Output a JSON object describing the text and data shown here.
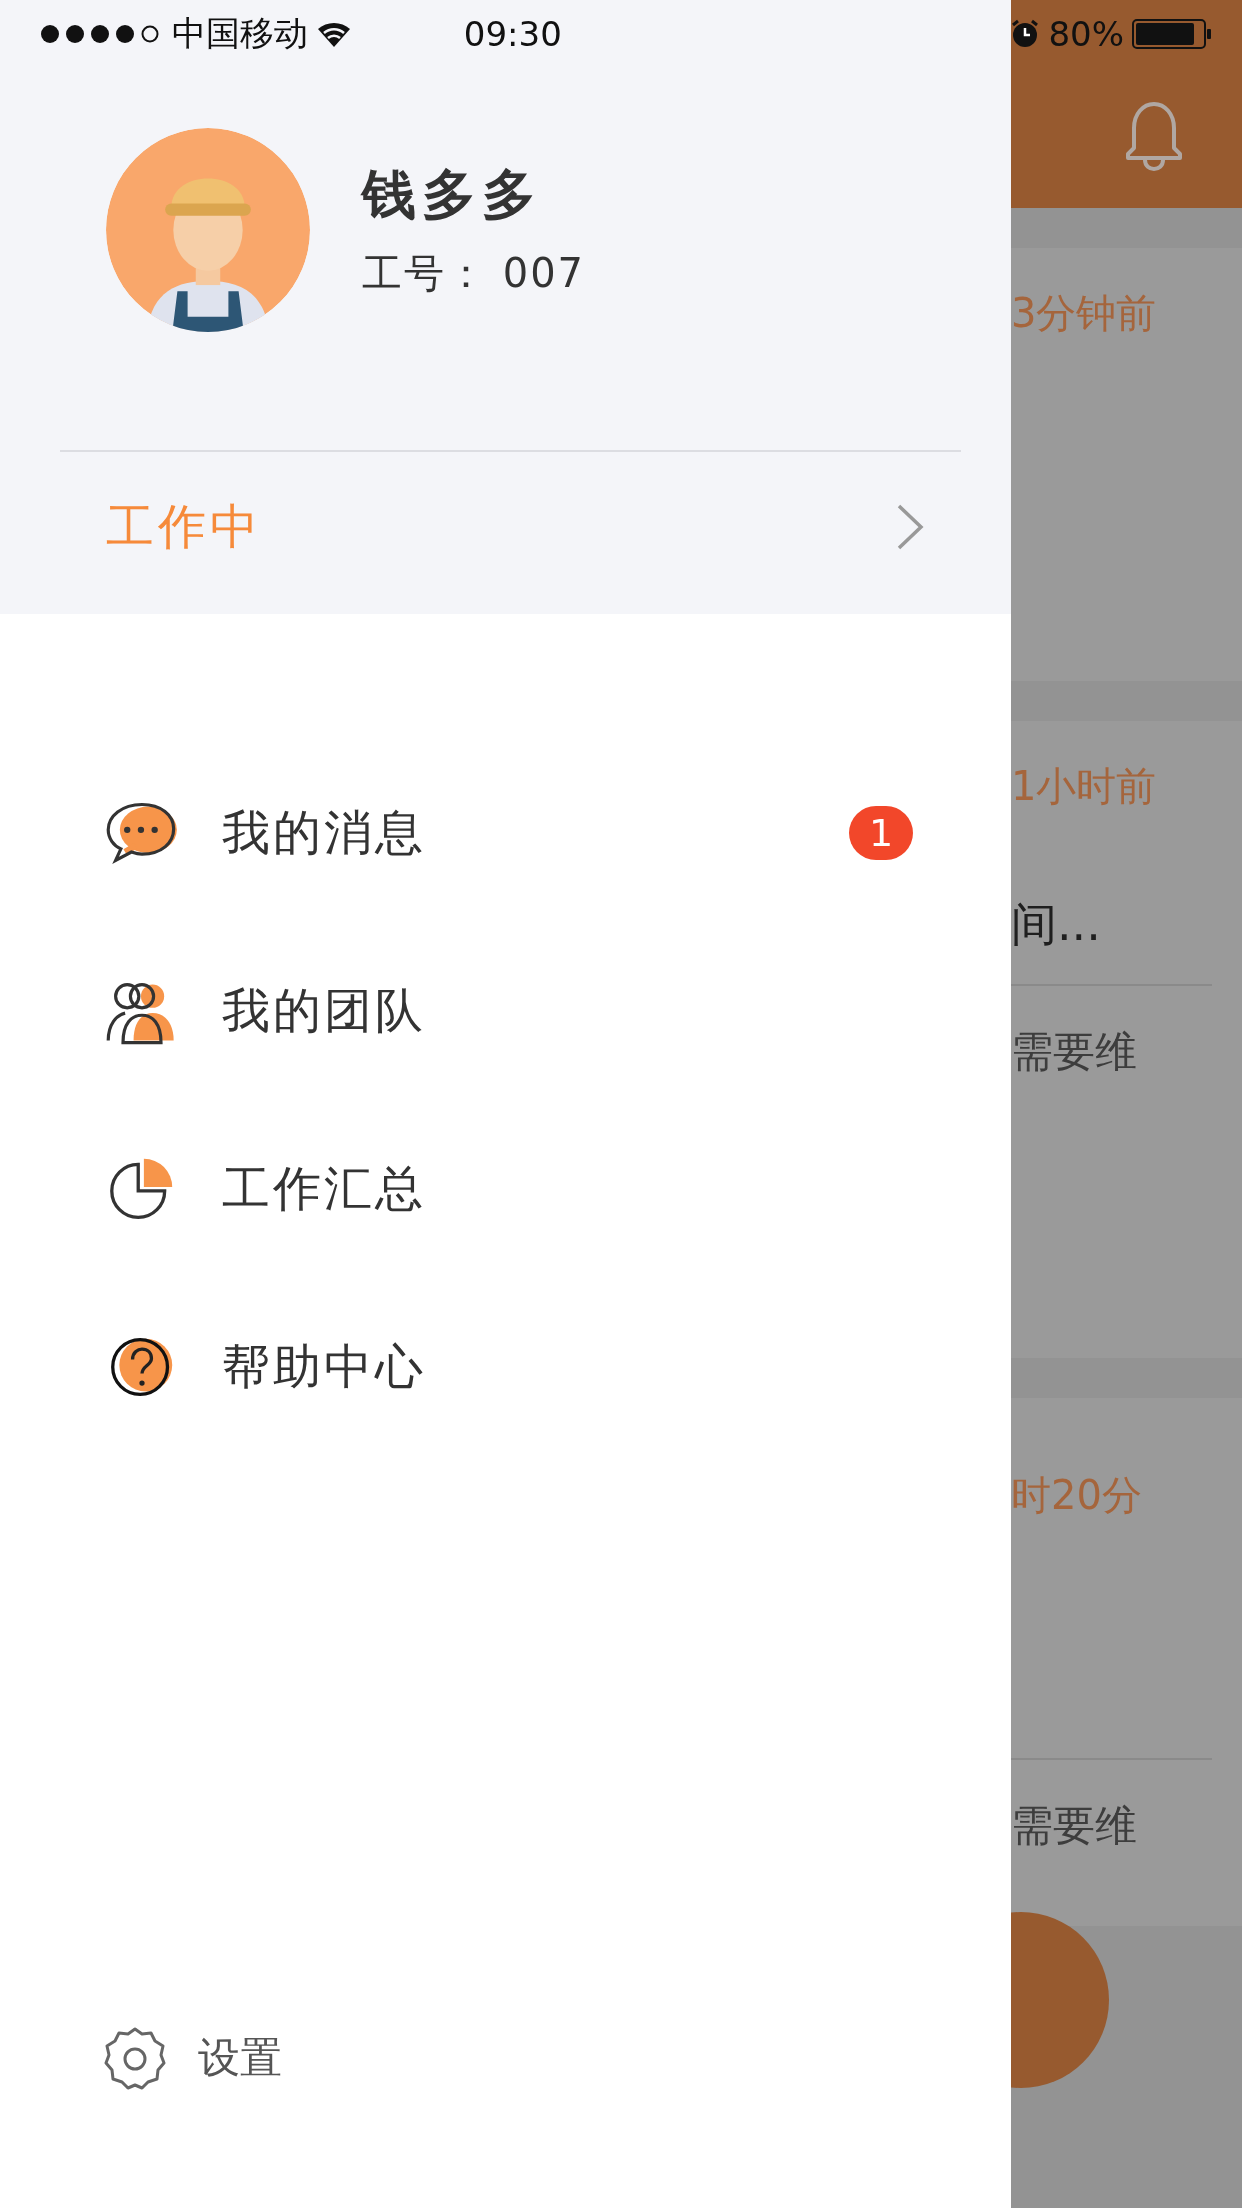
{
  "status_bar": {
    "carrier": "中国移动",
    "time": "09:30",
    "battery": "80%"
  },
  "profile": {
    "name": "钱多多",
    "employee_id": "工号： 007"
  },
  "work_status": {
    "label": "工作中"
  },
  "menu": [
    {
      "kind": "chat",
      "label": "我的消息",
      "badge": "1"
    },
    {
      "kind": "team",
      "label": "我的团队"
    },
    {
      "kind": "chart",
      "label": "工作汇总"
    },
    {
      "kind": "help",
      "label": "帮助中心"
    }
  ],
  "settings": {
    "label": "设置"
  },
  "background_screen": {
    "cards": [
      {
        "time": "3分钟前"
      },
      {
        "time": "1小时前",
        "title": "间...",
        "detail": "需要维"
      },
      {
        "time": "时20分",
        "detail": "需要维"
      }
    ]
  }
}
